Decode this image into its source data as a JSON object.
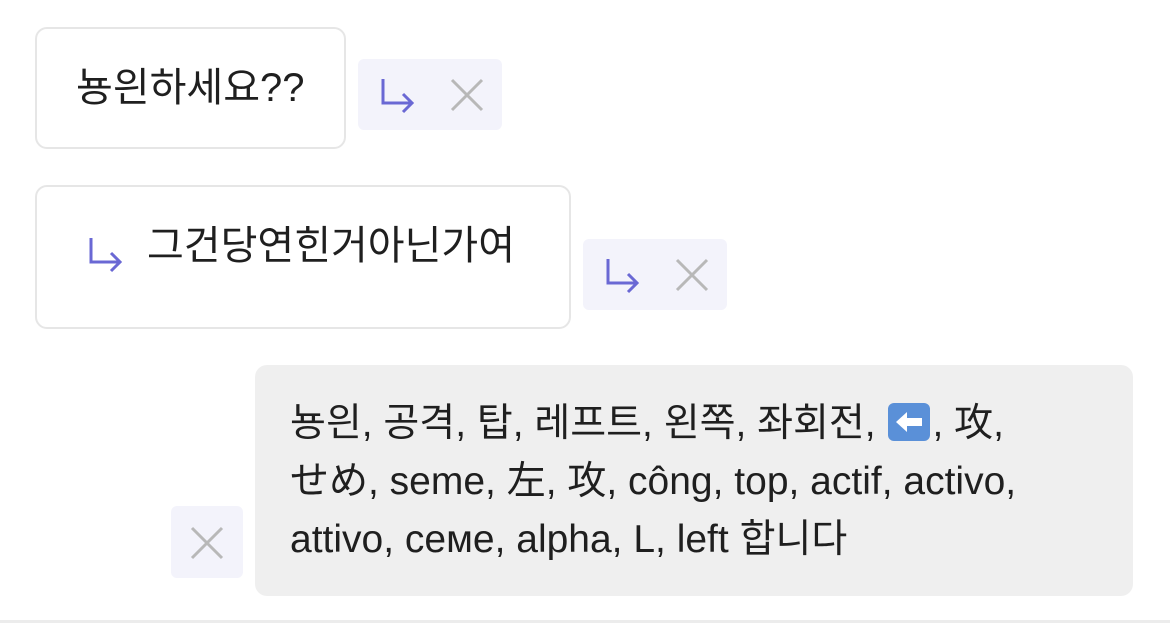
{
  "messages": [
    {
      "side": "left",
      "text": "뇽읜하세요??",
      "actions": [
        "reply-icon",
        "close-icon"
      ]
    },
    {
      "side": "left",
      "is_reply": true,
      "text": "그건당연힌거아닌가여",
      "actions": [
        "reply-icon",
        "close-icon"
      ]
    },
    {
      "side": "right",
      "lines": [
        {
          "before": "뇽읜, 공격, 탑, 레프트, 왼쪽, 좌회전, ",
          "emoji": "left-arrow-emoji",
          "after": ", 攻,"
        },
        {
          "text": "せめ, seme, 左, 攻, công, top, actif, activo,"
        },
        {
          "text": "attivo, семе, alpha, L, left 합니다"
        }
      ],
      "actions": [
        "close-icon"
      ]
    }
  ],
  "colors": {
    "accent": "#6a68d4",
    "icon_gray": "#b8b8b8",
    "bubble_border": "#e6e6e6",
    "bubble_right_bg": "#efefef",
    "action_bg": "#f3f3fb",
    "emoji_blue": "#5a90d8"
  }
}
